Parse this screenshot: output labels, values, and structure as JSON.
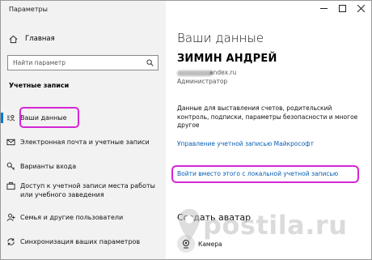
{
  "window": {
    "title": "Параметры"
  },
  "sidebar": {
    "home_label": "Главная",
    "search_placeholder": "Найти параметр",
    "section_title": "Учетные записи",
    "items": [
      {
        "label": "Ваши данные",
        "icon": "person-card-icon",
        "active": true
      },
      {
        "label": "Электронная почта и учетные записи",
        "icon": "mail-icon"
      },
      {
        "label": "Варианты входа",
        "icon": "key-icon"
      },
      {
        "label": "Доступ к учетной записи места работы или учебного заведения",
        "icon": "briefcase-icon"
      },
      {
        "label": "Семья и другие пользователи",
        "icon": "add-person-icon"
      },
      {
        "label": "Синхронизация ваших параметров",
        "icon": "sync-icon"
      }
    ]
  },
  "main": {
    "heading": "Ваши данные",
    "user_name": "ЗИМИН АНДРЕЙ",
    "email_visible": "andex.ru",
    "role": "Администратор",
    "description": "Данные для выставления счетов, родительский контроль, подписки, параметры безопасности и многое другое",
    "link_manage": "Управление учетной записью Майкрософт",
    "link_local": "Войти вместо этого с локальной учетной записью",
    "section_avatar": "Создать аватар",
    "camera_label": "Камера"
  },
  "watermark": {
    "text": "postila.ru"
  },
  "colors": {
    "accent": "#0078d7",
    "highlight": "#d526d5",
    "link": "#0a5fb4"
  }
}
